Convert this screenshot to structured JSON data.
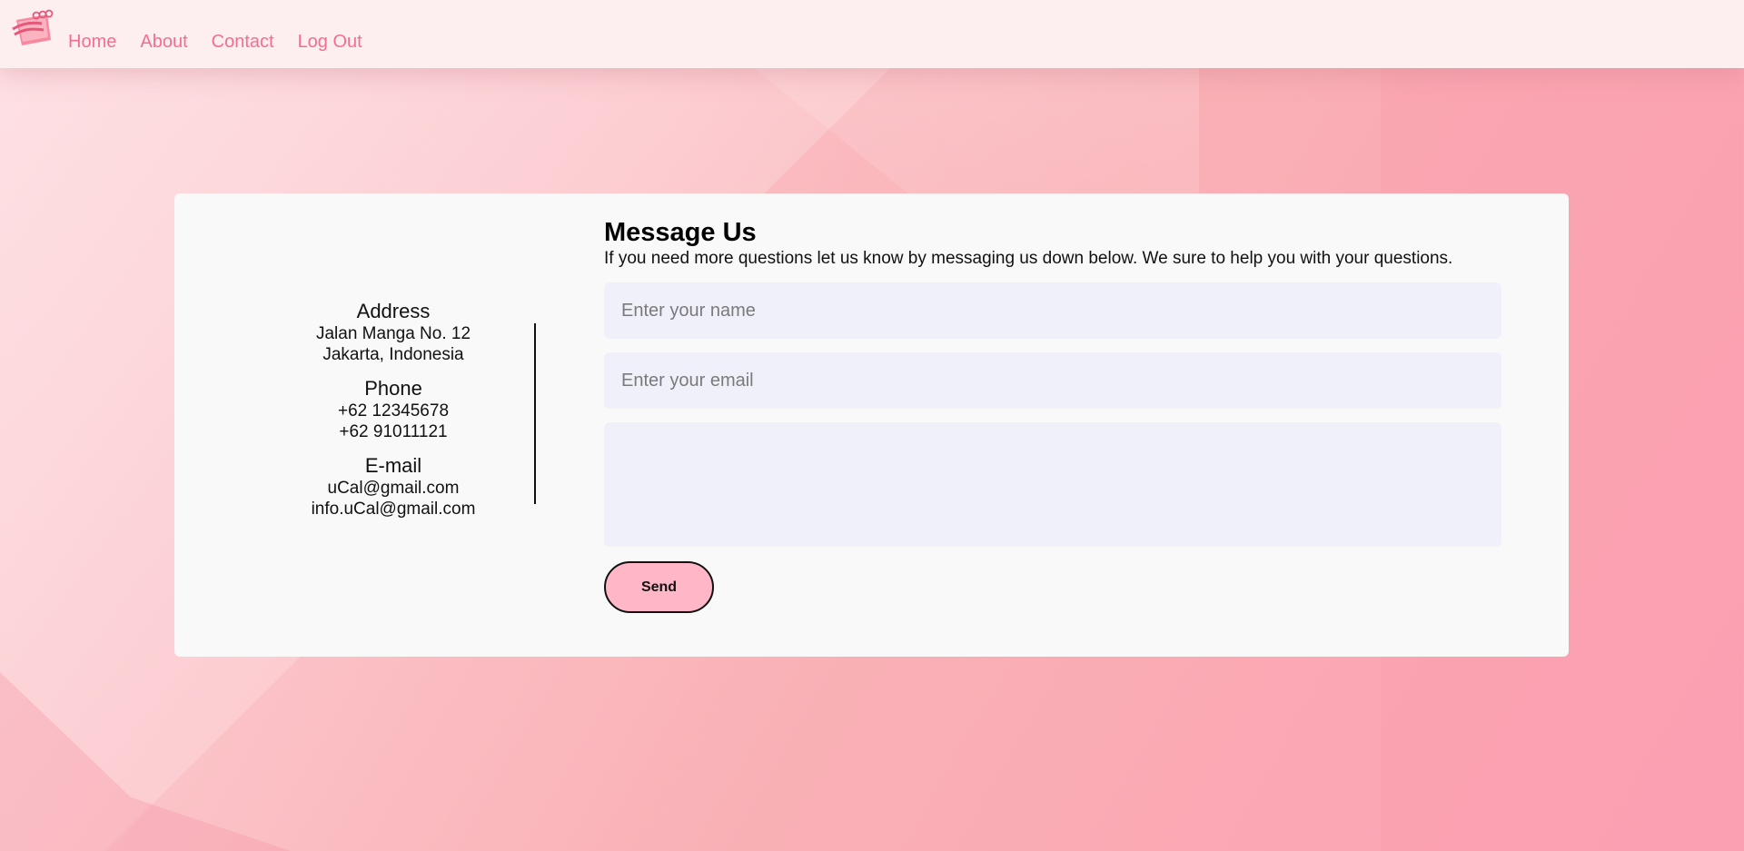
{
  "colors": {
    "accent": "#f56e8e",
    "navbar_bg": "#fdeef0",
    "card_bg": "#f9f9f9",
    "input_bg": "#f0f0fa",
    "button_bg": "#ffb6c6"
  },
  "navbar": {
    "logo_icon": "notepad-logo-icon",
    "links": [
      {
        "label": "Home"
      },
      {
        "label": "About"
      },
      {
        "label": "Contact"
      },
      {
        "label": "Log Out"
      }
    ]
  },
  "contact_info": {
    "address": {
      "heading": "Address",
      "lines": [
        "Jalan Manga No. 12",
        "Jakarta, Indonesia"
      ]
    },
    "phone": {
      "heading": "Phone",
      "lines": [
        "+62 12345678",
        "+62 91011121"
      ]
    },
    "email": {
      "heading": "E-mail",
      "lines": [
        "uCal@gmail.com",
        "info.uCal@gmail.com"
      ]
    }
  },
  "form": {
    "title": "Message Us",
    "subtitle": "If you need more questions let us know by messaging us down below. We sure to help you with your questions.",
    "name_placeholder": "Enter your name",
    "name_value": "",
    "email_placeholder": "Enter your email",
    "email_value": "",
    "message_placeholder": "",
    "message_value": "",
    "send_label": "Send"
  }
}
